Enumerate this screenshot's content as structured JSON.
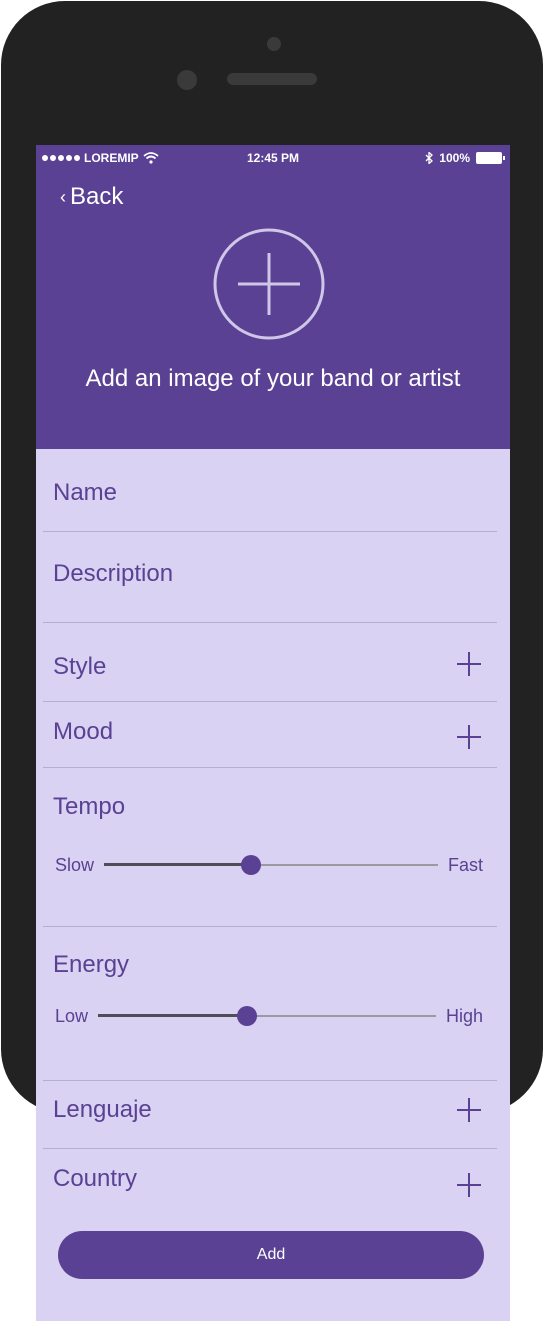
{
  "status_bar": {
    "carrier": "LOREMIP",
    "time": "12:45 PM",
    "battery": "100%",
    "signal_icon": "signal-dots-icon",
    "wifi_icon": "wifi-icon",
    "bluetooth_icon": "bluetooth-icon",
    "battery_icon": "battery-icon"
  },
  "header": {
    "back_label": "Back",
    "add_image_icon": "plus-circle-icon",
    "caption": "Add an image of your band or artist"
  },
  "form": {
    "name_label": "Name",
    "description_label": "Description",
    "style_label": "Style",
    "mood_label": "Mood",
    "tempo": {
      "label": "Tempo",
      "min_label": "Slow",
      "max_label": "Fast",
      "value": 0.44
    },
    "energy": {
      "label": "Energy",
      "min_label": "Low",
      "max_label": "High",
      "value": 0.44
    },
    "lenguaje_label": "Lenguaje",
    "country_label": "Country"
  },
  "actions": {
    "add_label": "Add"
  },
  "colors": {
    "accent": "#5a4194",
    "background": "#d9d2f2",
    "divider": "#b7aecd"
  }
}
